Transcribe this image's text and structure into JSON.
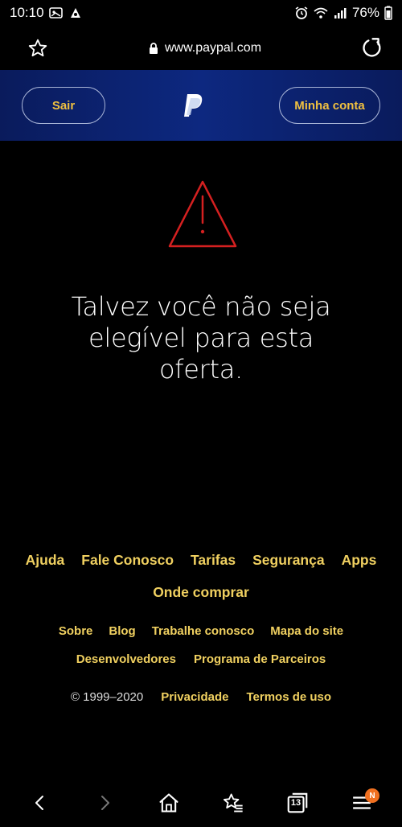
{
  "status": {
    "time": "10:10",
    "battery": "76%"
  },
  "browser": {
    "url": "www.paypal.com"
  },
  "header": {
    "logout_label": "Sair",
    "account_label": "Minha conta"
  },
  "main": {
    "message": "Talvez você não seja elegível para esta oferta."
  },
  "footer": {
    "primary_links": [
      "Ajuda",
      "Fale Conosco",
      "Tarifas",
      "Segurança",
      "Apps"
    ],
    "primary_link2": "Onde comprar",
    "secondary_links_row1": [
      "Sobre",
      "Blog",
      "Trabalhe conosco",
      "Mapa do site"
    ],
    "secondary_links_row2": [
      "Desenvolvedores",
      "Programa de Parceiros"
    ],
    "copyright": "© 1999–2020",
    "legal_links": [
      "Privacidade",
      "Termos de uso"
    ]
  },
  "bottom_nav": {
    "tab_count": "13",
    "menu_badge": "N"
  },
  "colors": {
    "header_blue": "#0d2880",
    "link_yellow": "#f0d060",
    "warning_red": "#d42020",
    "badge_orange": "#f07020"
  }
}
